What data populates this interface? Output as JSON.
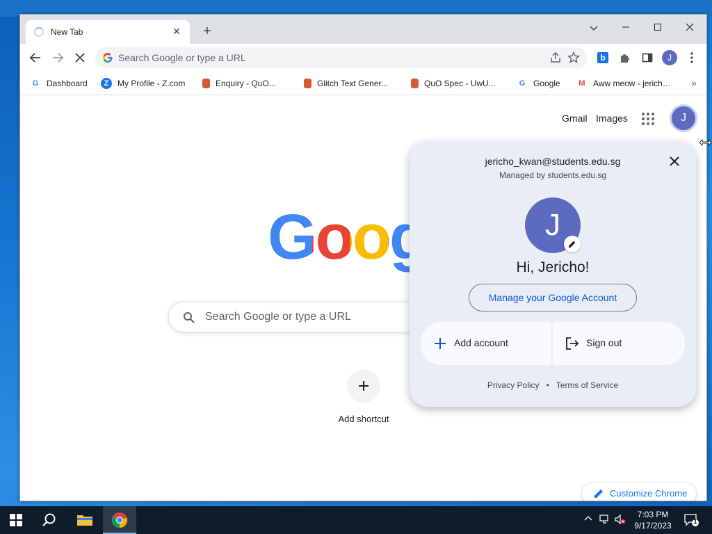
{
  "window": {
    "tab_title": "New Tab",
    "tab_close": "✕",
    "new_tab": "+",
    "controls": {
      "dropdown": "⌄",
      "minimize": "—",
      "maximize": "☐",
      "close": "✕"
    }
  },
  "toolbar": {
    "omnibox_placeholder": "Search Google or type a URL",
    "profile_initial": "J"
  },
  "bookmarks": [
    {
      "label": "Dashboard",
      "icon": "google-g-icon"
    },
    {
      "label": "My Profile - Z.com",
      "icon": "z-icon"
    },
    {
      "label": "Enquiry - QuO...",
      "icon": "doc-icon"
    },
    {
      "label": "Glitch Text Gener...",
      "icon": "doc-icon"
    },
    {
      "label": "QuO Spec - UwU...",
      "icon": "doc-icon"
    },
    {
      "label": "Google",
      "icon": "google-g-icon"
    },
    {
      "label": "Aww meow - jericho...",
      "icon": "gmail-icon"
    }
  ],
  "ntp": {
    "gmail": "Gmail",
    "images": "Images",
    "avatar_initial": "J",
    "logo_text": "Goog",
    "search_placeholder": "Search Google or type a URL",
    "add_shortcut": "Add shortcut",
    "customize": "Customize Chrome"
  },
  "account": {
    "email": "jericho_kwan@students.edu.sg",
    "managed": "Managed by students.edu.sg",
    "avatar_initial": "J",
    "greeting": "Hi, Jericho!",
    "manage_button": "Manage your Google Account",
    "add_account": "Add account",
    "sign_out": "Sign out",
    "privacy": "Privacy Policy",
    "separator": "•",
    "terms": "Terms of Service"
  },
  "taskbar": {
    "time": "7:03 PM",
    "date": "9/17/2023",
    "notifications": "1"
  },
  "colors": {
    "avatar": "#5c6bc0",
    "link_blue": "#0b57d0",
    "popup_bg": "#e9eef6"
  }
}
